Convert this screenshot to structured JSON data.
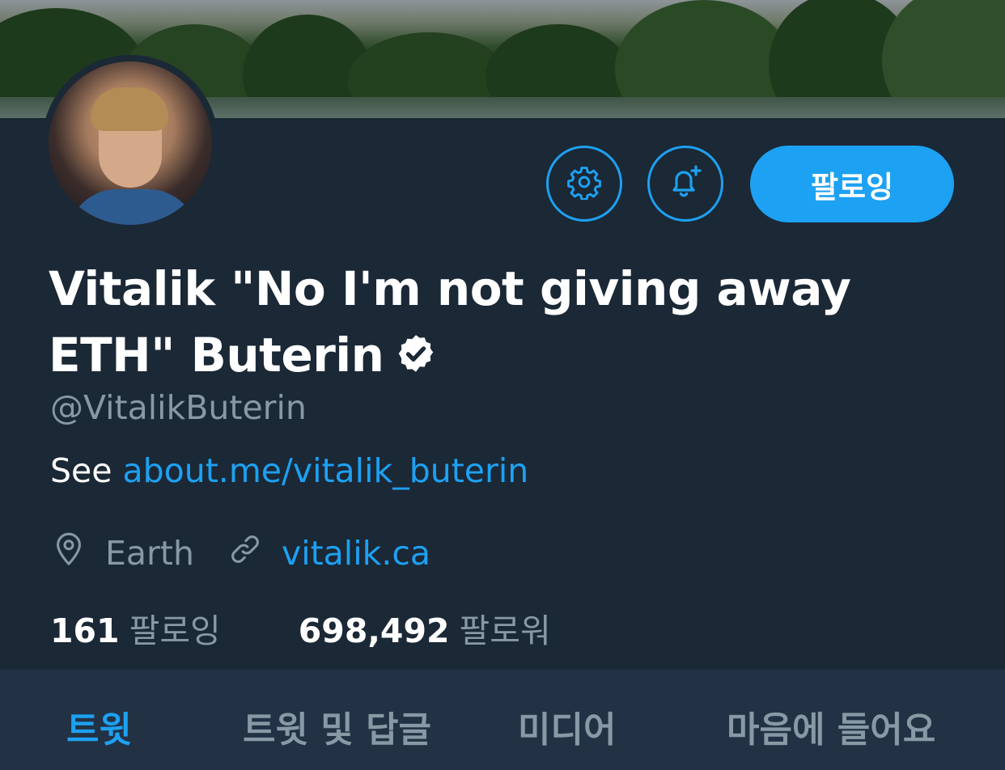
{
  "profile": {
    "display_name": "Vitalik \"No I'm not giving away ETH\" Buterin",
    "handle": "@VitalikButerin",
    "bio_prefix": "See ",
    "bio_link": "about.me/vitalik_buterin",
    "location": "Earth",
    "website": "vitalik.ca",
    "verified": true
  },
  "actions": {
    "settings_icon": "gear-icon",
    "notify_icon": "bell-plus-icon",
    "follow_label": "팔로잉"
  },
  "stats": {
    "following_count": "161",
    "following_label": "팔로잉",
    "followers_count": "698,492",
    "followers_label": "팔로워"
  },
  "tabs": [
    {
      "label": "트윗",
      "active": true
    },
    {
      "label": "트윗 및 답글",
      "active": false
    },
    {
      "label": "미디어",
      "active": false
    },
    {
      "label": "마음에 들어요",
      "active": false
    }
  ],
  "colors": {
    "accent": "#1da1f2",
    "background": "#1b2836",
    "tab_bar": "#223244",
    "secondary_text": "#8899a6"
  }
}
